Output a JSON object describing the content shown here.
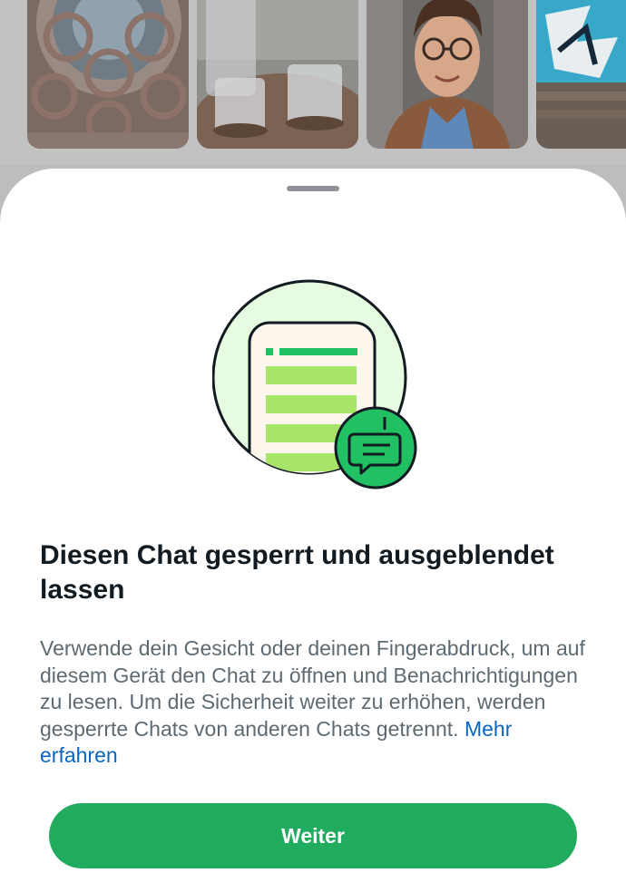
{
  "sheet": {
    "title": "Diesen Chat gesperrt und ausgeblendet lassen",
    "body": "Verwende dein Gesicht oder deinen Fingerabdruck, um auf diesem Gerät den Chat zu öffnen und Benachrichtigungen zu lesen. Um die Sicherheit weiter zu erhöhen, werden gesperrte Chats von anderen Chats getrennt. ",
    "learn_more_link": "Mehr erfahren",
    "continue_button": "Weiter"
  },
  "media_strip": {
    "thumbnails": [
      "rose-window-photo",
      "water-glasses-photo",
      "portrait-photo",
      "graffiti-photo"
    ]
  },
  "colors": {
    "accent_green": "#21ab5f",
    "link_blue": "#0a66c2",
    "title_text": "#121b22",
    "body_text": "#5e6a72",
    "illustration_bg": "#e7fbe0",
    "illustration_bar": "#a8e36a"
  }
}
